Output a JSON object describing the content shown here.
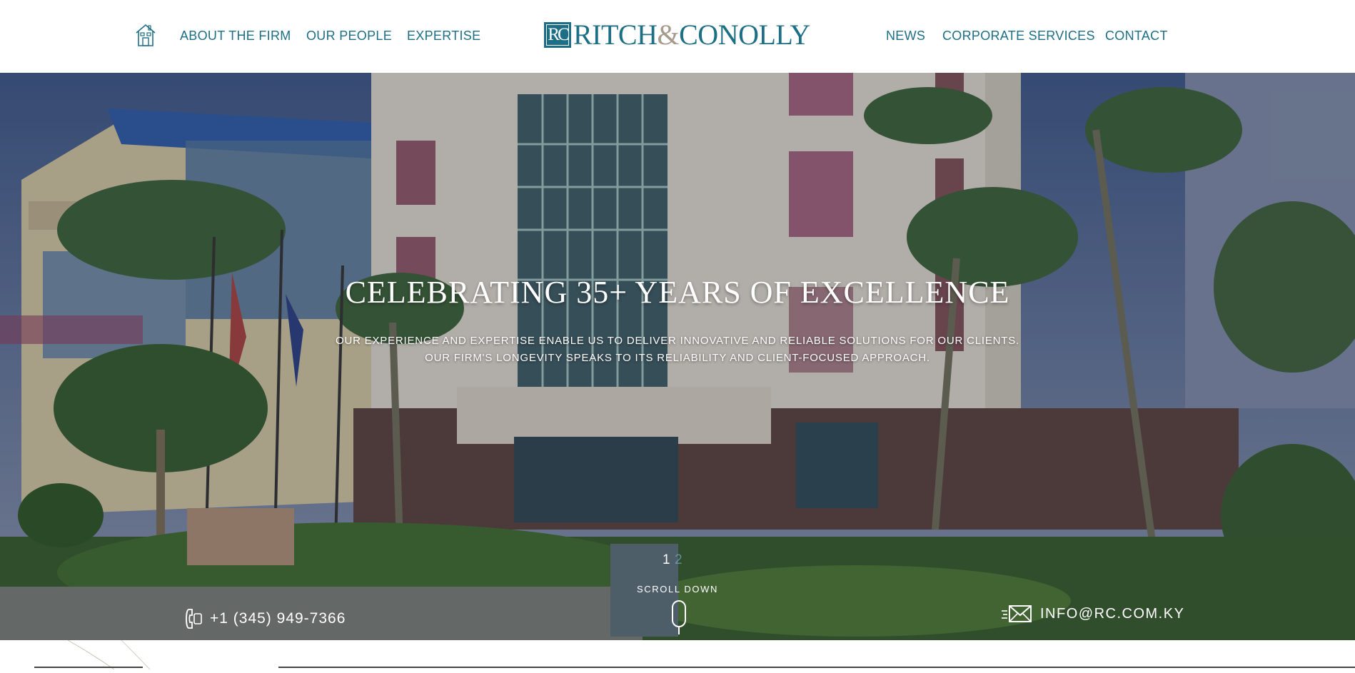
{
  "header": {
    "home_icon": "home-icon",
    "nav_left": [
      {
        "label": "ABOUT THE FIRM"
      },
      {
        "label": "OUR PEOPLE"
      },
      {
        "label": "EXPERTISE"
      }
    ],
    "logo": {
      "mark": "RC",
      "name_part1": "RITCH",
      "ampersand": "&",
      "name_part2": "CONOLLY"
    },
    "nav_right": [
      {
        "label": "NEWS"
      },
      {
        "label": "CORPORATE SERVICES"
      },
      {
        "label": "CONTACT"
      }
    ]
  },
  "hero": {
    "title": "CELEBRATING 35+ YEARS OF EXCELLENCE",
    "subtitle_line1": "OUR EXPERIENCE AND EXPERTISE ENABLE US TO DELIVER INNOVATIVE AND RELIABLE SOLUTIONS FOR OUR CLIENTS.",
    "subtitle_line2": "OUR FIRM'S LONGEVITY SPEAKS TO ITS RELIABILITY AND CLIENT-FOCUSED APPROACH.",
    "slide_number": "1",
    "slide_next": "2",
    "scroll_label": "SCROLL DOWN",
    "phone": "+1 (345) 949-7366",
    "email": "INFO@RC.COM.KY"
  },
  "colors": {
    "brand": "#1d6f86",
    "accent": "#a79b8c"
  },
  "icons": [
    "home-icon",
    "phone-icon",
    "envelope-icon",
    "mouse-scroll-icon"
  ]
}
